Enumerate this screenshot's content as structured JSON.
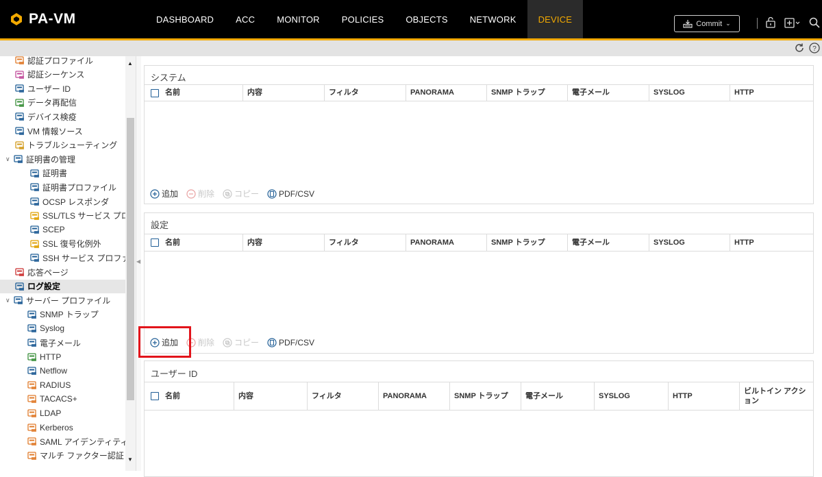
{
  "app": {
    "title": "PA-VM"
  },
  "nav": {
    "tabs": [
      {
        "label": "DASHBOARD",
        "active": false
      },
      {
        "label": "ACC",
        "active": false
      },
      {
        "label": "MONITOR",
        "active": false
      },
      {
        "label": "POLICIES",
        "active": false
      },
      {
        "label": "OBJECTS",
        "active": false
      },
      {
        "label": "NETWORK",
        "active": false
      },
      {
        "label": "DEVICE",
        "active": true
      }
    ],
    "commit_label": "Commit"
  },
  "colors": {
    "accent": "#f2a900",
    "topbar": "#000000",
    "checkbox": "#1f5d95",
    "highlight": "#e2141b"
  },
  "sidebar": {
    "items": [
      {
        "label": "認証プロファイル",
        "icon": "auth-profile-icon"
      },
      {
        "label": "認証シーケンス",
        "icon": "auth-sequence-icon"
      },
      {
        "label": "ユーザー ID",
        "icon": "user-id-icon"
      },
      {
        "label": "データ再配信",
        "icon": "data-redistribution-icon"
      },
      {
        "label": "デバイス検疫",
        "icon": "device-quarantine-icon"
      },
      {
        "label": "VM 情報ソース",
        "icon": "vm-info-icon"
      },
      {
        "label": "トラブルシューティング",
        "icon": "troubleshooting-icon"
      },
      {
        "label": "証明書の管理",
        "icon": "certificate-management-icon"
      },
      {
        "label": "証明書",
        "icon": "certificate-icon"
      },
      {
        "label": "証明書プロファイル",
        "icon": "certificate-profile-icon"
      },
      {
        "label": "OCSP レスポンダ",
        "icon": "ocsp-icon"
      },
      {
        "label": "SSL/TLS サービス プロ",
        "icon": "lock-icon"
      },
      {
        "label": "SCEP",
        "icon": "scep-icon"
      },
      {
        "label": "SSL 復号化例外",
        "icon": "lock-icon"
      },
      {
        "label": "SSH サービス プロファ",
        "icon": "ssh-icon"
      },
      {
        "label": "応答ページ",
        "icon": "response-page-icon"
      },
      {
        "label": "ログ設定",
        "icon": "log-settings-icon"
      },
      {
        "label": "サーバー プロファイル",
        "icon": "server-profile-icon"
      },
      {
        "label": "SNMP トラップ",
        "icon": "snmp-icon"
      },
      {
        "label": "Syslog",
        "icon": "syslog-icon"
      },
      {
        "label": "電子メール",
        "icon": "email-icon"
      },
      {
        "label": "HTTP",
        "icon": "http-icon"
      },
      {
        "label": "Netflow",
        "icon": "netflow-icon"
      },
      {
        "label": "RADIUS",
        "icon": "radius-icon"
      },
      {
        "label": "TACACS+",
        "icon": "tacacs-icon"
      },
      {
        "label": "LDAP",
        "icon": "ldap-icon"
      },
      {
        "label": "Kerberos",
        "icon": "kerberos-icon"
      },
      {
        "label": "SAML アイデンティティ",
        "icon": "saml-icon"
      },
      {
        "label": "マルチ ファクター認証",
        "icon": "mfa-icon"
      }
    ]
  },
  "panels": {
    "system": {
      "title": "システム",
      "columns": [
        "名前",
        "内容",
        "フィルタ",
        "PANORAMA",
        "SNMP トラップ",
        "電子メール",
        "SYSLOG",
        "HTTP"
      ]
    },
    "config": {
      "title": "設定",
      "columns": [
        "名前",
        "内容",
        "フィルタ",
        "PANORAMA",
        "SNMP トラップ",
        "電子メール",
        "SYSLOG",
        "HTTP"
      ]
    },
    "userid": {
      "title": "ユーザー ID",
      "columns": [
        "名前",
        "内容",
        "フィルタ",
        "PANORAMA",
        "SNMP トラップ",
        "電子メール",
        "SYSLOG",
        "HTTP",
        "ビルトイン アクション"
      ]
    }
  },
  "toolbar": {
    "add": "追加",
    "delete": "削除",
    "copy": "コピー",
    "pdfcsv": "PDF/CSV"
  }
}
